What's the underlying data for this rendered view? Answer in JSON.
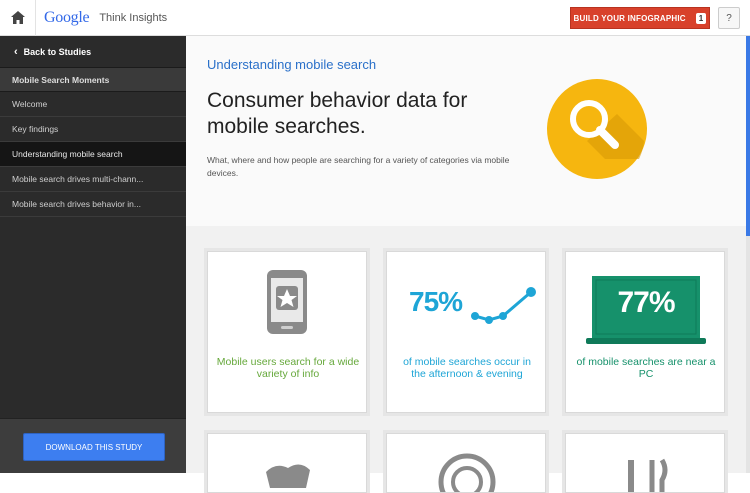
{
  "header": {
    "logo": "Google",
    "product": "Think Insights",
    "build_label": "BUILD YOUR INFOGRAPHIC",
    "build_count": "1",
    "help_label": "?"
  },
  "sidebar": {
    "back_label": "Back to Studies",
    "section_title": "Mobile Search Moments",
    "items": [
      {
        "label": "Welcome"
      },
      {
        "label": "Key findings"
      },
      {
        "label": "Understanding mobile search"
      },
      {
        "label": "Mobile search drives multi-chann..."
      },
      {
        "label": "Mobile search drives behavior in..."
      }
    ],
    "download_label": "DOWNLOAD THIS STUDY"
  },
  "main": {
    "section_link": "Understanding mobile search",
    "heading": "Consumer behavior data for mobile searches.",
    "subtext": "What, where and how people are searching for a variety of categories via mobile devices.",
    "cards": [
      {
        "caption": "Mobile users search for a wide variety of info",
        "color": "#66a83b"
      },
      {
        "stat": "75%",
        "caption": "of mobile searches occur in the afternoon & evening",
        "color": "#1ea5d6"
      },
      {
        "stat": "77%",
        "caption": "of mobile searches are near a PC",
        "color": "#16916b"
      }
    ]
  },
  "colors": {
    "accent": "#d8412b",
    "link": "#2a70c9",
    "sidebar_bg": "#2b2b2b",
    "hero_icon": "#f6b60f",
    "download": "#3d7ef0"
  }
}
